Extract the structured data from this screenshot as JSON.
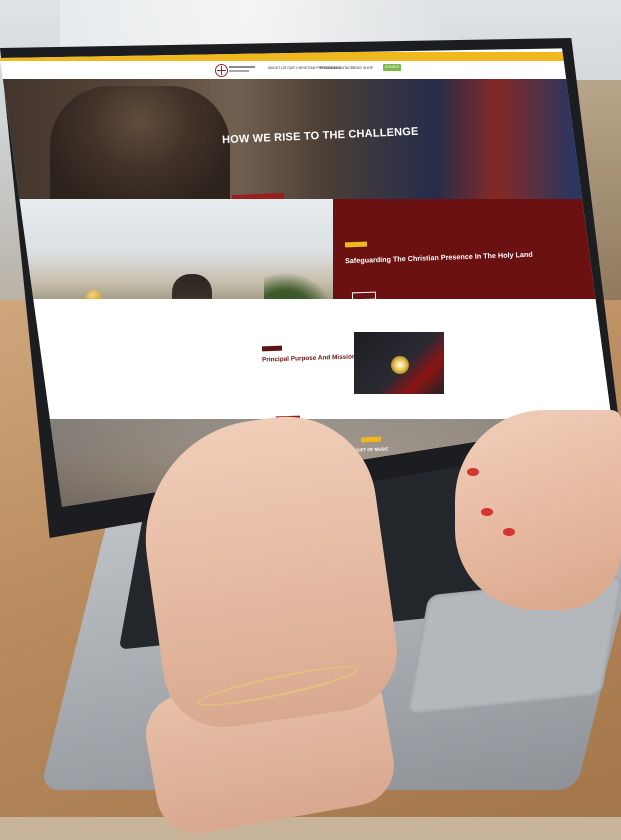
{
  "topbar": {
    "text": ""
  },
  "nav": {
    "items": [
      "ABOUT US",
      "OUR CHRISTIAN PRESENCE",
      "PROGRAMS",
      "CONTACT",
      "NEWS",
      "SHOP"
    ],
    "donate_label": "DONATE"
  },
  "hero": {
    "title": "HOW WE RISE TO THE CHALLENGE",
    "text": "",
    "button_label": ""
  },
  "safeguard": {
    "badge": "",
    "title": "Safeguarding The Christian Presence In The Holy Land",
    "text": "",
    "button_label": ""
  },
  "purpose": {
    "badge": "",
    "title": "Principal Purpose And Mission",
    "text": "",
    "button_label": ""
  },
  "video": {
    "label": ""
  },
  "music": {
    "badge": "",
    "title": "GIFT OF MUSIC",
    "text": "",
    "button_label": ""
  },
  "colors": {
    "accent_yellow": "#f0b81f",
    "maroon": "#6b1111",
    "button_red": "#8e1c1c",
    "donate_green": "#7fb54a",
    "nail_polish": "#d3342d"
  },
  "icons": [
    "cross-logo-icon",
    "play-disc-icon"
  ]
}
